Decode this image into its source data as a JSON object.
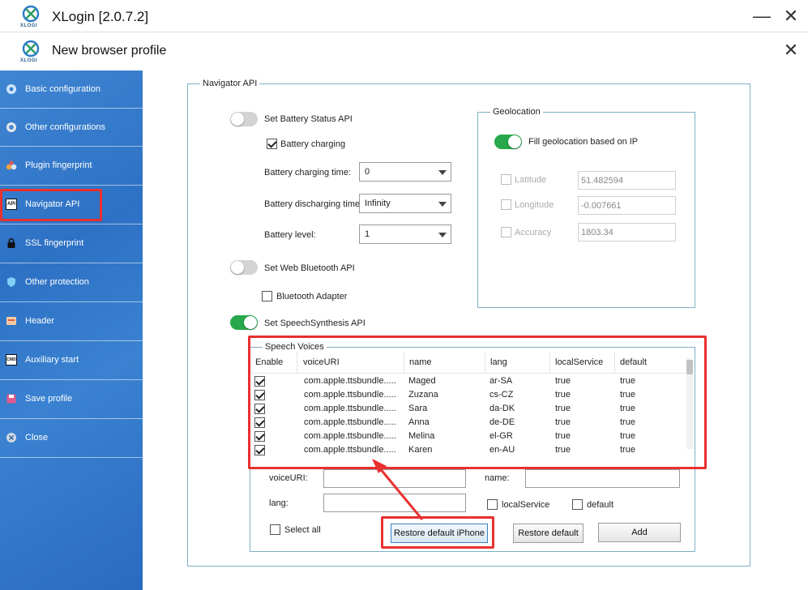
{
  "window": {
    "title": "XLogin [2.0.7.2]",
    "subtitle": "New browser profile",
    "logo_text": "XLOGI",
    "minimize_glyph": "—",
    "close_glyph": "✕"
  },
  "sidebar": {
    "items": [
      {
        "label": "Basic configuration",
        "icon": "basic-icon"
      },
      {
        "label": "Other configurations",
        "icon": "chrome-icon"
      },
      {
        "label": "Plugin fingerprint",
        "icon": "plugin-icon"
      },
      {
        "label": "Navigator API",
        "icon": "api-icon",
        "badge": "API"
      },
      {
        "label": "SSL fingerprint",
        "icon": "lock-icon"
      },
      {
        "label": "Other protection",
        "icon": "protect-icon"
      },
      {
        "label": "Header",
        "icon": "header-icon"
      },
      {
        "label": "Auxiliary start",
        "icon": "cmd-icon",
        "badge": "CMD"
      },
      {
        "label": "Save profile",
        "icon": "save-icon"
      },
      {
        "label": "Close",
        "icon": "close-icon"
      }
    ],
    "selected": "Navigator API"
  },
  "navigator": {
    "group_title": "Navigator API",
    "battery": {
      "toggle_label": "Set Battery Status API",
      "enabled": false,
      "charging_label": "Battery charging",
      "charging_checked": true,
      "charging_time_label": "Battery charging time:",
      "charging_time_value": "0",
      "discharging_time_label": "Battery discharging time",
      "discharging_time_value": "Infinity",
      "level_label": "Battery level:",
      "level_value": "1"
    },
    "bluetooth": {
      "toggle_label": "Set Web Bluetooth API",
      "enabled": false,
      "adapter_label": "Bluetooth Adapter",
      "adapter_checked": false
    },
    "speech": {
      "toggle_label": "Set SpeechSynthesis API",
      "enabled": true,
      "voices_title": "Speech Voices",
      "columns": [
        "Enable",
        "voiceURI",
        "name",
        "lang",
        "localService",
        "default"
      ],
      "rows": [
        {
          "enable": true,
          "voiceURI": "com.apple.ttsbundle.....",
          "name": "Maged",
          "lang": "ar-SA",
          "localService": "true",
          "default": "true"
        },
        {
          "enable": true,
          "voiceURI": "com.apple.ttsbundle.....",
          "name": "Zuzana",
          "lang": "cs-CZ",
          "localService": "true",
          "default": "true"
        },
        {
          "enable": true,
          "voiceURI": "com.apple.ttsbundle.....",
          "name": "Sara",
          "lang": "da-DK",
          "localService": "true",
          "default": "true"
        },
        {
          "enable": true,
          "voiceURI": "com.apple.ttsbundle.....",
          "name": "Anna",
          "lang": "de-DE",
          "localService": "true",
          "default": "true"
        },
        {
          "enable": true,
          "voiceURI": "com.apple.ttsbundle.....",
          "name": "Melina",
          "lang": "el-GR",
          "localService": "true",
          "default": "true"
        },
        {
          "enable": true,
          "voiceURI": "com.apple.ttsbundle.....",
          "name": "Karen",
          "lang": "en-AU",
          "localService": "true",
          "default": "true"
        }
      ],
      "form": {
        "voiceuri_label": "voiceURI:",
        "name_label": "name:",
        "lang_label": "lang:",
        "localservice_label": "localService",
        "default_label": "default",
        "select_all_label": "Select all"
      },
      "buttons": {
        "restore_iphone": "Restore default iPhone",
        "restore_default": "Restore default",
        "add": "Add"
      }
    },
    "geolocation": {
      "title": "Geolocation",
      "toggle_label": "Fill geolocation based on IP",
      "enabled": true,
      "latitude_label": "Latitude",
      "latitude_value": "51.482594",
      "longitude_label": "Longitude",
      "longitude_value": "-0.007661",
      "accuracy_label": "Accuracy",
      "accuracy_value": "1803.34"
    }
  },
  "colors": {
    "sidebar": "#3579c9",
    "highlight": "#e8302e",
    "toggle_on": "#27a84a",
    "group_border": "#7fb0c8"
  }
}
